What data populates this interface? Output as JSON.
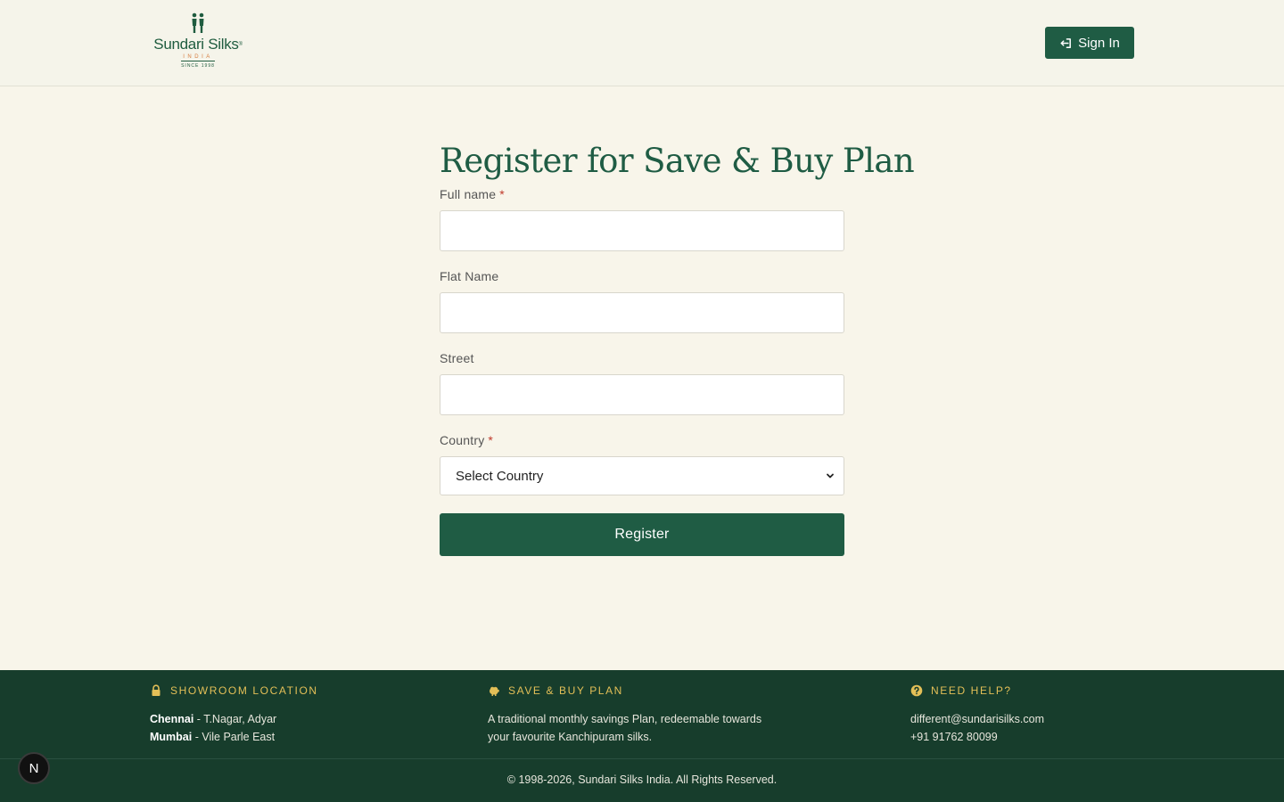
{
  "header": {
    "logo": {
      "brand": "Sundari Silks",
      "registered": "®",
      "subtitle": "INDIA",
      "since": "SINCE 1998"
    },
    "signin_label": "Sign In",
    "signin_icon": "sign-in-icon"
  },
  "form": {
    "title": "Register for Save & Buy Plan",
    "required_mark": "*",
    "full_name_label": "Full name",
    "full_name_value": "",
    "flat_name_label": "Flat Name",
    "flat_name_value": "",
    "street_label": "Street",
    "street_value": "",
    "country_label": "Country",
    "country_selected": "Select Country",
    "register_label": "Register"
  },
  "footer": {
    "showroom": {
      "heading": "SHOWROOM LOCATION",
      "icon": "lock-icon",
      "chennai_city": "Chennai",
      "chennai_areas": "- T.Nagar, Adyar",
      "mumbai_city": "Mumbai",
      "mumbai_areas": "- Vile Parle East"
    },
    "plan": {
      "heading": "SAVE & BUY PLAN",
      "icon": "piggy-bank-icon",
      "line1": "A traditional monthly savings Plan, redeemable towards",
      "line2": "your favourite Kanchipuram silks."
    },
    "help": {
      "heading": "NEED HELP?",
      "icon": "question-circle-icon",
      "email": "different@sundarisilks.com",
      "phone": "+91 91762 80099"
    },
    "copyright": "© 1998-2026, Sundari Silks India. All Rights Reserved."
  },
  "badge": {
    "letter": "N"
  },
  "colors": {
    "brand_green": "#1f5c44",
    "footer_bg": "#173d2c",
    "accent_gold": "#e3bf57",
    "page_bg": "#f8f5ea",
    "required_red": "#c0392b"
  }
}
